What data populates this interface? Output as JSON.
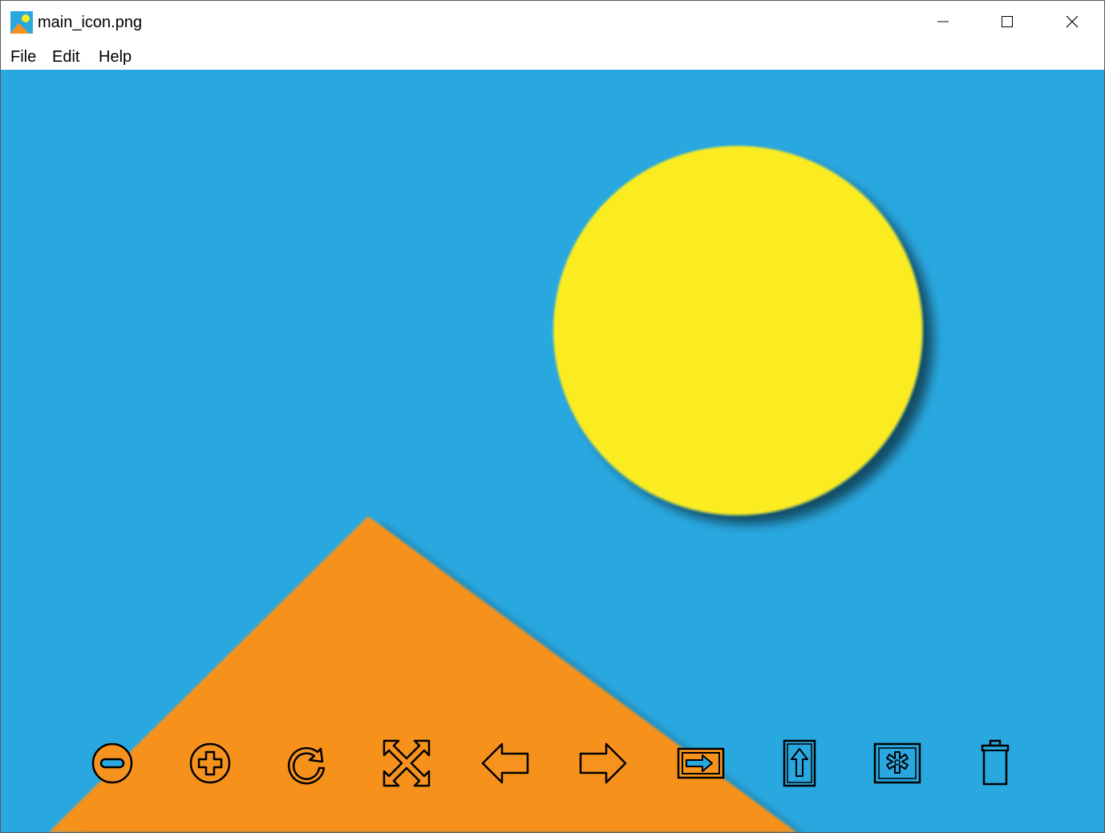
{
  "window": {
    "title": "main_icon.png",
    "icon": "image-app-icon",
    "controls": [
      "minimize",
      "maximize",
      "close"
    ]
  },
  "menu": {
    "items": [
      "File",
      "Edit",
      "Help"
    ]
  },
  "image": {
    "colors": {
      "sky": "#29a8e0",
      "sun": "#fbec21",
      "mountain": "#f6921e"
    }
  },
  "toolbar": {
    "colors": {
      "icon_fill": "#f6921e",
      "icon_stroke": "#000000"
    },
    "buttons": [
      {
        "icon": "zoom-out-icon"
      },
      {
        "icon": "zoom-in-icon"
      },
      {
        "icon": "rotate-icon"
      },
      {
        "icon": "fit-to-window-icon"
      },
      {
        "icon": "previous-arrow-icon"
      },
      {
        "icon": "next-arrow-icon"
      },
      {
        "icon": "open-with-icon"
      },
      {
        "icon": "upload-icon"
      },
      {
        "icon": "settings-icon"
      },
      {
        "icon": "delete-trash-icon"
      }
    ]
  }
}
